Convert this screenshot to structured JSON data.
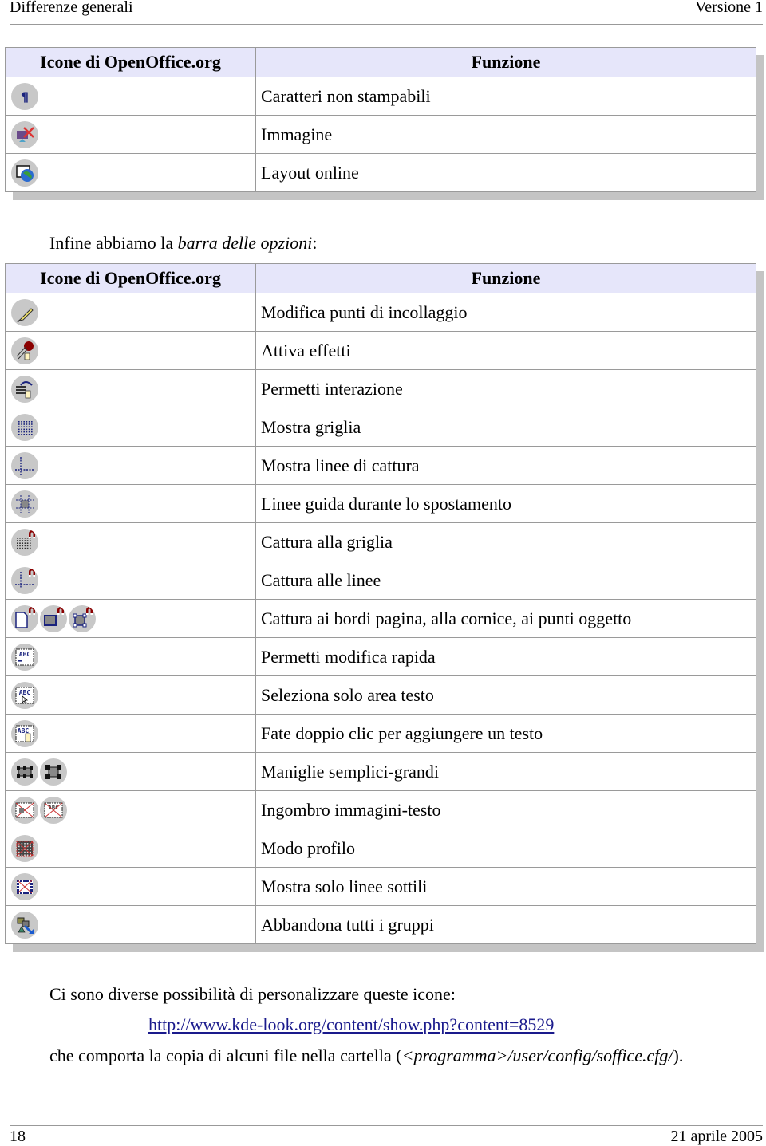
{
  "header": {
    "left": "Differenze generali",
    "right": "Versione 1"
  },
  "table1": {
    "col_icon": "Icone di OpenOffice.org",
    "col_func": "Funzione",
    "rows": [
      {
        "icons": [
          "pilcrow-icon"
        ],
        "label": "Caratteri non stampabili"
      },
      {
        "icons": [
          "image-off-icon"
        ],
        "label": "Immagine"
      },
      {
        "icons": [
          "online-layout-icon"
        ],
        "label": "Layout online"
      }
    ]
  },
  "intro": {
    "text": "Infine abbiamo la ",
    "italic": "barra delle opzioni",
    "suffix": ":"
  },
  "table2": {
    "col_icon": "Icone di OpenOffice.org",
    "col_func": "Funzione",
    "rows": [
      {
        "icons": [
          "edit-glue-points-icon"
        ],
        "label": "Modifica punti di incollaggio"
      },
      {
        "icons": [
          "activate-effects-icon"
        ],
        "label": "Attiva effetti"
      },
      {
        "icons": [
          "allow-interaction-icon"
        ],
        "label": "Permetti interazione"
      },
      {
        "icons": [
          "show-grid-icon"
        ],
        "label": "Mostra griglia"
      },
      {
        "icons": [
          "show-snap-lines-icon"
        ],
        "label": "Mostra linee di cattura"
      },
      {
        "icons": [
          "guides-when-moving-icon"
        ],
        "label": "Linee guida durante lo spostamento"
      },
      {
        "icons": [
          "snap-to-grid-icon"
        ],
        "label": "Cattura alla griglia"
      },
      {
        "icons": [
          "snap-to-lines-icon"
        ],
        "label": "Cattura alle linee"
      },
      {
        "icons": [
          "snap-page-margins-icon",
          "snap-object-border-icon",
          "snap-object-points-icon"
        ],
        "label": "Cattura ai bordi pagina, alla cornice, ai punti oggetto"
      },
      {
        "icons": [
          "quick-edit-icon"
        ],
        "label": "Permetti modifica rapida"
      },
      {
        "icons": [
          "select-text-area-icon"
        ],
        "label": "Seleziona solo area testo"
      },
      {
        "icons": [
          "double-click-text-icon"
        ],
        "label": "Fate doppio clic per aggiungere un testo"
      },
      {
        "icons": [
          "simple-handles-icon",
          "large-handles-icon"
        ],
        "label": "Maniglie semplici-grandi"
      },
      {
        "icons": [
          "image-placeholders-icon",
          "text-placeholders-icon"
        ],
        "label": "Ingombro immagini-testo"
      },
      {
        "icons": [
          "contour-mode-icon"
        ],
        "label": "Modo profilo"
      },
      {
        "icons": [
          "line-contour-icon"
        ],
        "label": "Mostra solo linee sottili"
      },
      {
        "icons": [
          "exit-all-groups-icon"
        ],
        "label": "Abbandona tutti i gruppi"
      }
    ]
  },
  "outro": {
    "line1": "Ci sono diverse possibilità di personalizzare queste icone:",
    "link": "http://www.kde-look.org/content/show.php?content=8529",
    "line3_pre": "che comporta la copia di alcuni file nella cartella (",
    "line3_italic": "<programma>/user/config/soffice.cfg/",
    "line3_post": ")."
  },
  "footer": {
    "left": "18",
    "right": "21 aprile 2005"
  }
}
